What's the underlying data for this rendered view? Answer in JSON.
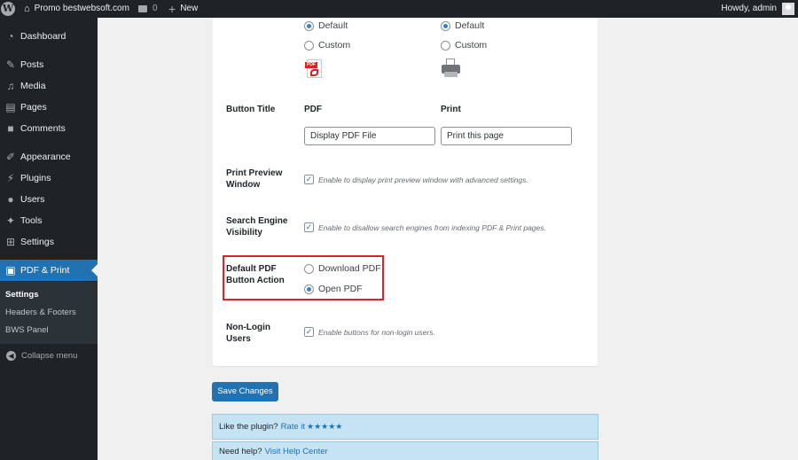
{
  "adminbar": {
    "site_name": "Promo bestwebsoft.com",
    "comments_count": "0",
    "new_label": "New",
    "howdy": "Howdy, admin"
  },
  "sidebar": {
    "items": [
      {
        "label": "Dashboard",
        "icon": "dashboard-icon"
      },
      {
        "label": "Posts",
        "icon": "pin-icon"
      },
      {
        "label": "Media",
        "icon": "media-icon"
      },
      {
        "label": "Pages",
        "icon": "page-icon"
      },
      {
        "label": "Comments",
        "icon": "comment-icon"
      },
      {
        "label": "Appearance",
        "icon": "brush-icon"
      },
      {
        "label": "Plugins",
        "icon": "plug-icon"
      },
      {
        "label": "Users",
        "icon": "user-icon"
      },
      {
        "label": "Tools",
        "icon": "wrench-icon"
      },
      {
        "label": "Settings",
        "icon": "settings-icon"
      },
      {
        "label": "PDF & Print",
        "icon": "pdf-print-icon"
      }
    ],
    "submenu": [
      "Settings",
      "Headers & Footers",
      "BWS Panel"
    ],
    "collapse": "Collapse menu"
  },
  "settings": {
    "icon_pdf_options": [
      "Default",
      "Custom"
    ],
    "icon_print_options": [
      "Default",
      "Custom"
    ],
    "button_title": {
      "label": "Button Title",
      "pdf_head": "PDF",
      "print_head": "Print",
      "pdf_value": "Display PDF File",
      "print_value": "Print this page"
    },
    "print_preview": {
      "label_line1": "Print Preview",
      "label_line2": "Window",
      "hint": "Enable to display print preview window with advanced settings."
    },
    "search_engine": {
      "label_line1": "Search Engine",
      "label_line2": "Visibility",
      "hint": "Enable to disallow search engines from indexing PDF & Print pages."
    },
    "default_action": {
      "label_line1": "Default PDF",
      "label_line2": "Button Action",
      "options": [
        "Download PDF",
        "Open PDF"
      ]
    },
    "non_login": {
      "label_line1": "Non-Login",
      "label_line2": "Users",
      "hint": "Enable buttons for non-login users."
    }
  },
  "save_button": "Save Changes",
  "notices": {
    "rate_text": "Like the plugin?",
    "rate_link": "Rate it",
    "stars": "★★★★★",
    "help_text": "Need help?",
    "help_link": "Visit Help Center"
  },
  "colors": {
    "accent": "#2271b1",
    "highlight": "#d9232e",
    "adminbar": "#1d2327",
    "notice_bg": "#c5e3f3"
  }
}
